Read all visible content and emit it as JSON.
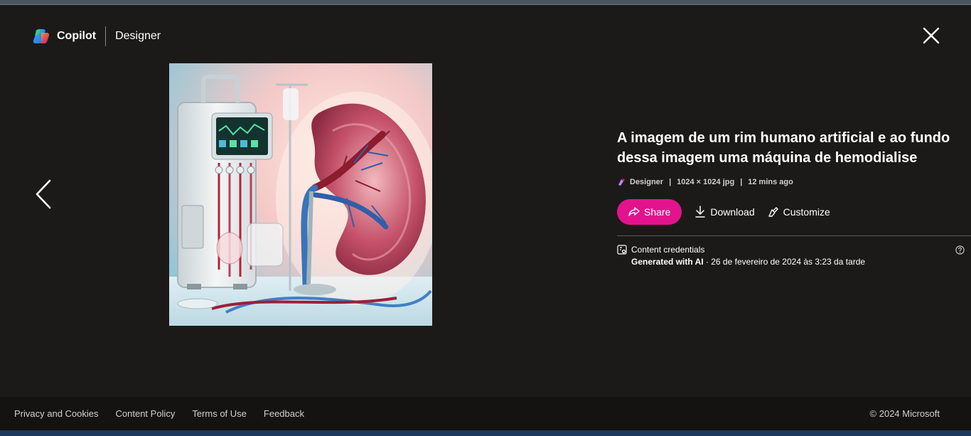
{
  "header": {
    "brand": "Copilot",
    "product": "Designer"
  },
  "icons": {
    "logo": "copilot-logo",
    "close": "close-icon",
    "prev": "chevron-left-icon",
    "share": "share-icon",
    "download": "download-icon",
    "customize": "customize-icon",
    "credentials": "content-credentials-icon",
    "help": "help-icon",
    "designer": "designer-icon"
  },
  "image": {
    "alt": "A imagem de um rim humano artificial e ao fundo dessa imagem uma máquina de hemodialise"
  },
  "details": {
    "title": "A imagem de um rim humano artificial e ao fundo dessa imagem uma máquina de hemodialise",
    "meta": {
      "source": "Designer",
      "dimensions": "1024 × 1024 jpg",
      "time": "12 mins ago",
      "separator": "|"
    },
    "actions": {
      "share": "Share",
      "download": "Download",
      "customize": "Customize"
    },
    "credentials": {
      "label": "Content credentials",
      "generated": "Generated with AI",
      "date": " · 26 de fevereiro de 2024 às 3:23 da tarde"
    }
  },
  "footer": {
    "links": [
      "Privacy and Cookies",
      "Content Policy",
      "Terms of Use",
      "Feedback"
    ],
    "copyright": "© 2024 Microsoft"
  },
  "colors": {
    "background": "#1b1a19",
    "accent": "#e3138d",
    "footer_bg": "#141312"
  }
}
